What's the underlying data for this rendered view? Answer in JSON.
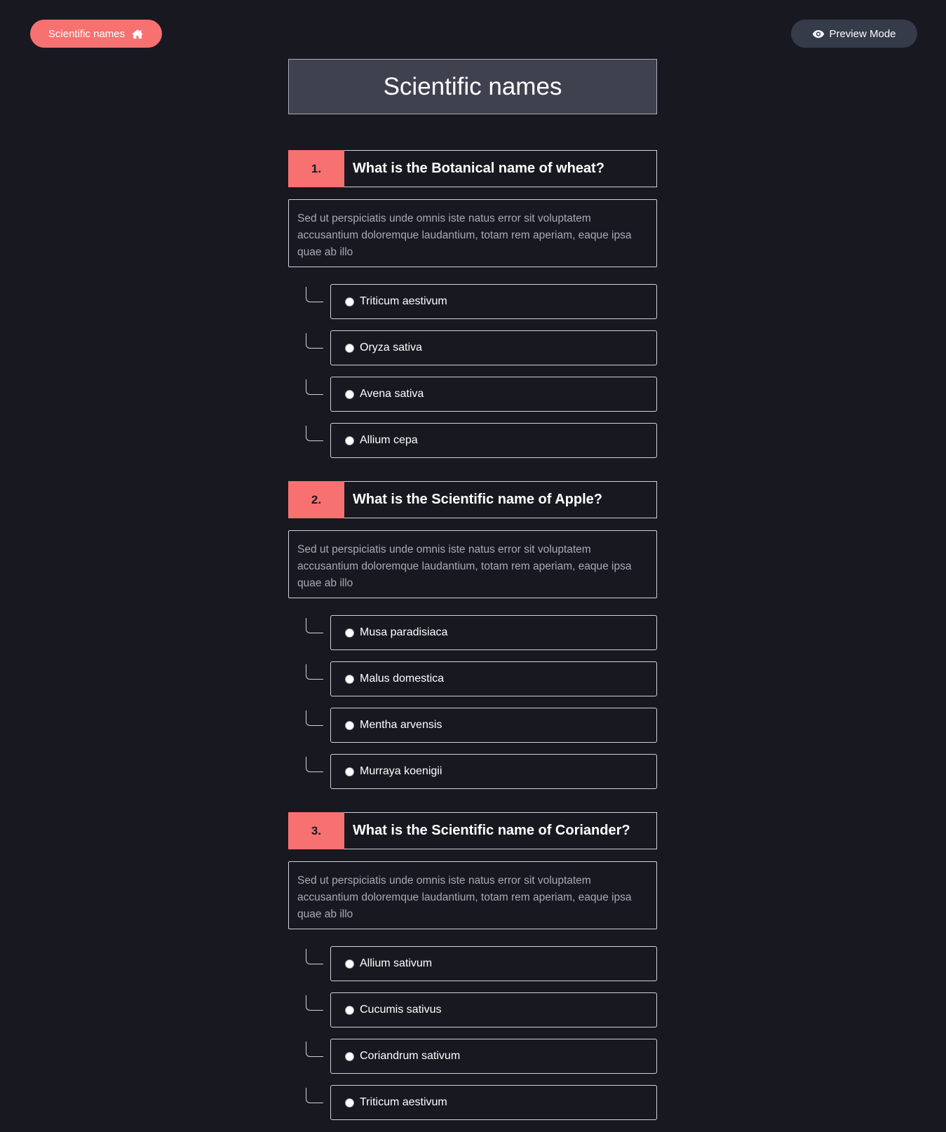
{
  "header": {
    "home_label": "Scientific names",
    "home_icon": "home-icon",
    "preview_label": "Preview Mode",
    "preview_icon": "eye-icon"
  },
  "quiz": {
    "title": "Scientific names",
    "questions": [
      {
        "number": "1.",
        "text": "What is the Botanical name of wheat?",
        "description": "Sed ut perspiciatis unde omnis iste natus error sit voluptatem accusantium doloremque laudantium, totam rem aperiam, eaque ipsa quae ab illo",
        "options": [
          "Triticum aestivum",
          "Oryza sativa",
          "Avena sativa",
          "Allium cepa"
        ]
      },
      {
        "number": "2.",
        "text": "What is the Scientific name of Apple?",
        "description": "Sed ut perspiciatis unde omnis iste natus error sit voluptatem accusantium doloremque laudantium, totam rem aperiam, eaque ipsa quae ab illo",
        "options": [
          "Musa paradisiaca",
          "Malus domestica",
          "Mentha arvensis",
          "Murraya koenigii"
        ]
      },
      {
        "number": "3.",
        "text": "What is the Scientific name of Coriander?",
        "description": "Sed ut perspiciatis unde omnis iste natus error sit voluptatem accusantium doloremque laudantium, totam rem aperiam, eaque ipsa quae ab illo",
        "options": [
          "Allium sativum",
          "Cucumis sativus",
          "Coriandrum sativum",
          "Triticum aestivum"
        ]
      }
    ]
  },
  "colors": {
    "background": "#181920",
    "accent": "#f87171",
    "title_box": "#40414f",
    "preview_pill": "#363b4a"
  }
}
